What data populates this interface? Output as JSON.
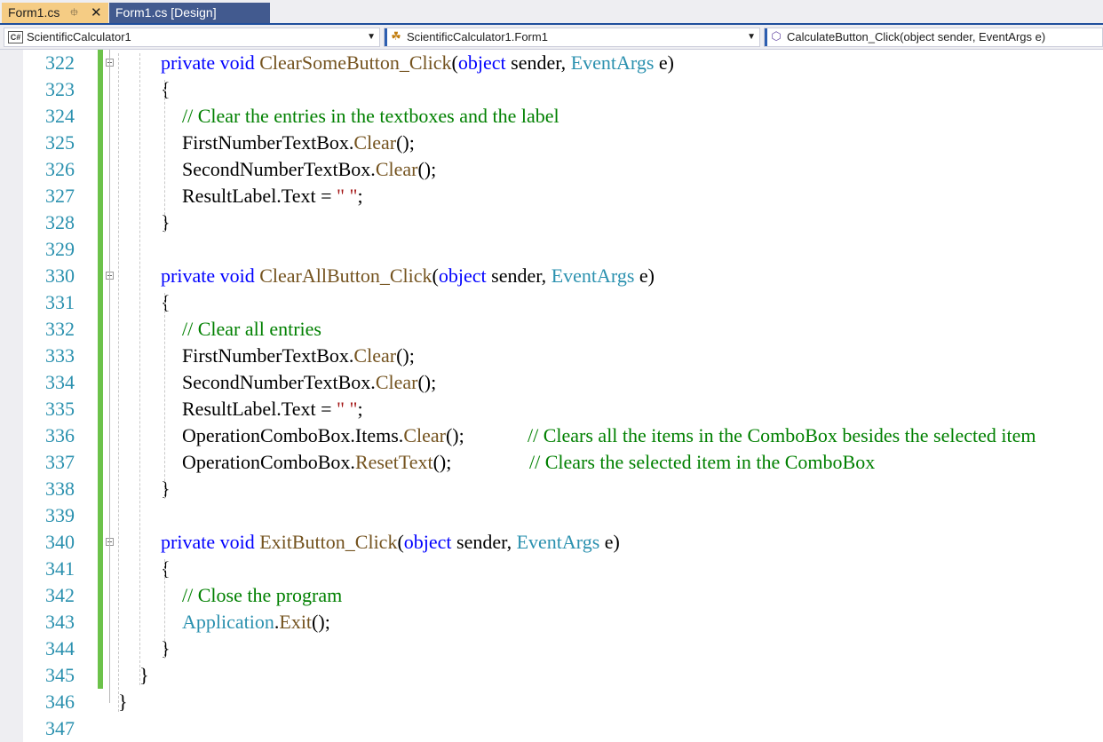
{
  "tabs": [
    {
      "label": "Form1.cs",
      "active": true,
      "pin_icon": "pin-icon",
      "close_icon": "close-icon"
    },
    {
      "label": "Form1.cs [Design]",
      "active": false
    }
  ],
  "navbar": {
    "project": {
      "icon": "csharp-project-icon",
      "icon_text": "C#",
      "label": "ScientificCalculator1"
    },
    "class": {
      "icon": "class-icon",
      "label": "ScientificCalculator1.Form1"
    },
    "member": {
      "icon": "method-icon",
      "label": "CalculateButton_Click(object sender, EventArgs e)"
    }
  },
  "colors": {
    "keyword": "#0000ff",
    "method": "#74531f",
    "type": "#2b91af",
    "comment": "#008000",
    "line_number": "#2b91af",
    "change_bar": "#6cc24a",
    "active_tab": "#f5cc84"
  },
  "editor": {
    "lines": [
      {
        "num": "322",
        "tokens": [
          [
            "kw",
            "private"
          ],
          [
            "t",
            " "
          ],
          [
            "kw",
            "void"
          ],
          [
            "t",
            " "
          ],
          [
            "mth",
            "ClearSomeButton_Click"
          ],
          [
            "t",
            "("
          ],
          [
            "kw",
            "object"
          ],
          [
            "t",
            " sender, "
          ],
          [
            "typ",
            "EventArgs"
          ],
          [
            "t",
            " e)"
          ]
        ]
      },
      {
        "num": "323",
        "tokens": [
          [
            "t",
            "{"
          ]
        ]
      },
      {
        "num": "324",
        "tokens": [
          [
            "cmt",
            "// Clear the entries in the textboxes and the label"
          ]
        ]
      },
      {
        "num": "325",
        "tokens": [
          [
            "t",
            "FirstNumberTextBox."
          ],
          [
            "mth",
            "Clear"
          ],
          [
            "t",
            "();"
          ]
        ]
      },
      {
        "num": "326",
        "tokens": [
          [
            "t",
            "SecondNumberTextBox."
          ],
          [
            "mth",
            "Clear"
          ],
          [
            "t",
            "();"
          ]
        ]
      },
      {
        "num": "327",
        "tokens": [
          [
            "t",
            "ResultLabel.Text = "
          ],
          [
            "str",
            "\" \""
          ],
          [
            "t",
            ";"
          ]
        ]
      },
      {
        "num": "328",
        "tokens": [
          [
            "t",
            "}"
          ]
        ]
      },
      {
        "num": "329",
        "tokens": []
      },
      {
        "num": "330",
        "tokens": [
          [
            "kw",
            "private"
          ],
          [
            "t",
            " "
          ],
          [
            "kw",
            "void"
          ],
          [
            "t",
            " "
          ],
          [
            "mth",
            "ClearAllButton_Click"
          ],
          [
            "t",
            "("
          ],
          [
            "kw",
            "object"
          ],
          [
            "t",
            " sender, "
          ],
          [
            "typ",
            "EventArgs"
          ],
          [
            "t",
            " e)"
          ]
        ]
      },
      {
        "num": "331",
        "tokens": [
          [
            "t",
            "{"
          ]
        ]
      },
      {
        "num": "332",
        "tokens": [
          [
            "cmt",
            "// Clear all entries"
          ]
        ]
      },
      {
        "num": "333",
        "tokens": [
          [
            "t",
            "FirstNumberTextBox."
          ],
          [
            "mth",
            "Clear"
          ],
          [
            "t",
            "();"
          ]
        ]
      },
      {
        "num": "334",
        "tokens": [
          [
            "t",
            "SecondNumberTextBox."
          ],
          [
            "mth",
            "Clear"
          ],
          [
            "t",
            "();"
          ]
        ]
      },
      {
        "num": "335",
        "tokens": [
          [
            "t",
            "ResultLabel.Text = "
          ],
          [
            "str",
            "\" \""
          ],
          [
            "t",
            ";"
          ]
        ]
      },
      {
        "num": "336",
        "tokens": [
          [
            "t",
            "OperationComboBox.Items."
          ],
          [
            "mth",
            "Clear"
          ],
          [
            "t",
            "();"
          ]
        ],
        "comment": "// Clears all the items in the ComboBox besides the selected item"
      },
      {
        "num": "337",
        "tokens": [
          [
            "t",
            "OperationComboBox."
          ],
          [
            "mth",
            "ResetText"
          ],
          [
            "t",
            "();"
          ]
        ],
        "comment": "// Clears the selected item in the ComboBox"
      },
      {
        "num": "338",
        "tokens": [
          [
            "t",
            "}"
          ]
        ]
      },
      {
        "num": "339",
        "tokens": []
      },
      {
        "num": "340",
        "tokens": [
          [
            "kw",
            "private"
          ],
          [
            "t",
            " "
          ],
          [
            "kw",
            "void"
          ],
          [
            "t",
            " "
          ],
          [
            "mth",
            "ExitButton_Click"
          ],
          [
            "t",
            "("
          ],
          [
            "kw",
            "object"
          ],
          [
            "t",
            " sender, "
          ],
          [
            "typ",
            "EventArgs"
          ],
          [
            "t",
            " e)"
          ]
        ]
      },
      {
        "num": "341",
        "tokens": [
          [
            "t",
            "{"
          ]
        ]
      },
      {
        "num": "342",
        "tokens": [
          [
            "cmt",
            "// Close the program"
          ]
        ]
      },
      {
        "num": "343",
        "tokens": [
          [
            "typ",
            "Application"
          ],
          [
            "t",
            "."
          ],
          [
            "mth",
            "Exit"
          ],
          [
            "t",
            "();"
          ]
        ]
      },
      {
        "num": "344",
        "tokens": [
          [
            "t",
            "}"
          ]
        ]
      },
      {
        "num": "345",
        "tokens": [
          [
            "t",
            "}"
          ]
        ]
      },
      {
        "num": "346",
        "tokens": [
          [
            "t",
            "}"
          ]
        ]
      },
      {
        "num": "347",
        "tokens": []
      }
    ]
  }
}
